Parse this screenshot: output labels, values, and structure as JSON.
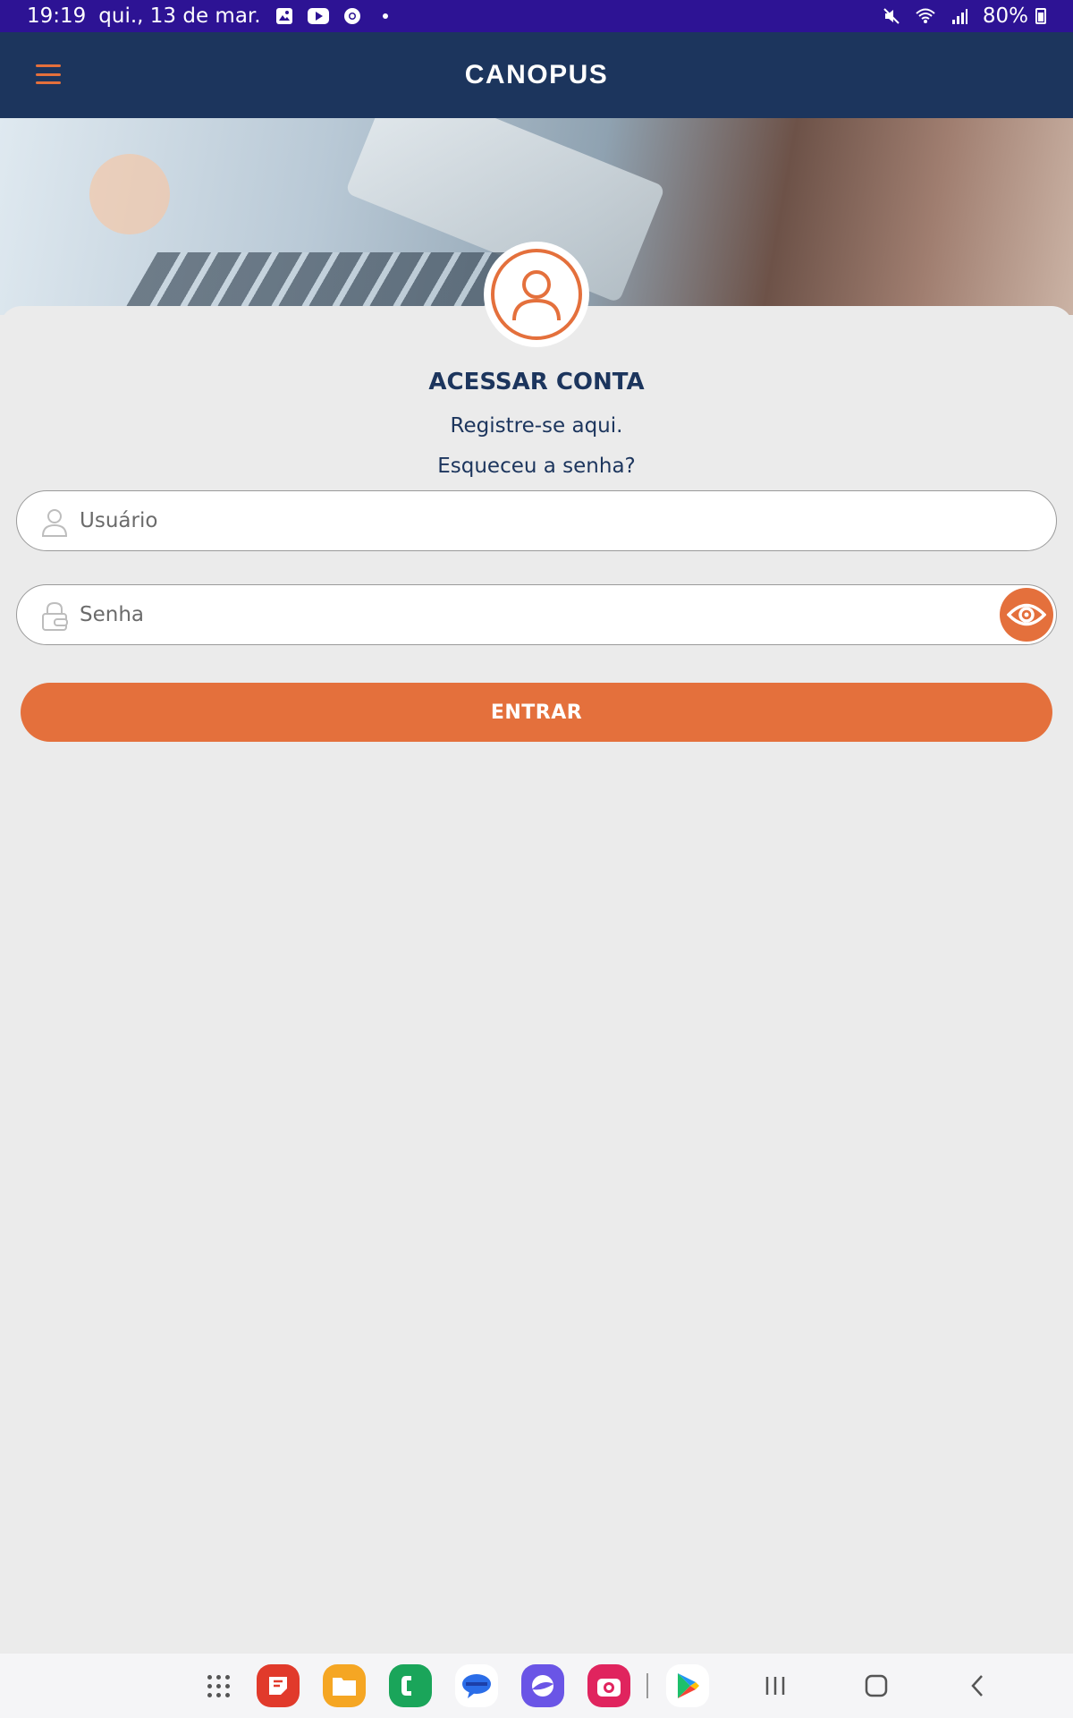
{
  "status_bar": {
    "time": "19:19",
    "date": "qui., 13 de mar.",
    "battery": "80%"
  },
  "header": {
    "brand": "CANOPUS",
    "menu_icon": "hamburger-icon"
  },
  "login": {
    "title": "ACESSAR CONTA",
    "register_link": "Registre-se aqui.",
    "forgot_link": "Esqueceu a senha?",
    "username_placeholder": "Usuário",
    "password_placeholder": "Senha",
    "submit_label": "ENTRAR"
  },
  "colors": {
    "accent": "#e4703c",
    "header_bg": "#1c355d",
    "status_bar_bg": "#2d1394",
    "page_bg": "#ebebeb"
  },
  "dock": {
    "apps": [
      "notes-app-icon",
      "files-app-icon",
      "phone-app-icon",
      "messages-app-icon",
      "browser-app-icon",
      "camera-app-icon",
      "play-store-icon"
    ]
  }
}
